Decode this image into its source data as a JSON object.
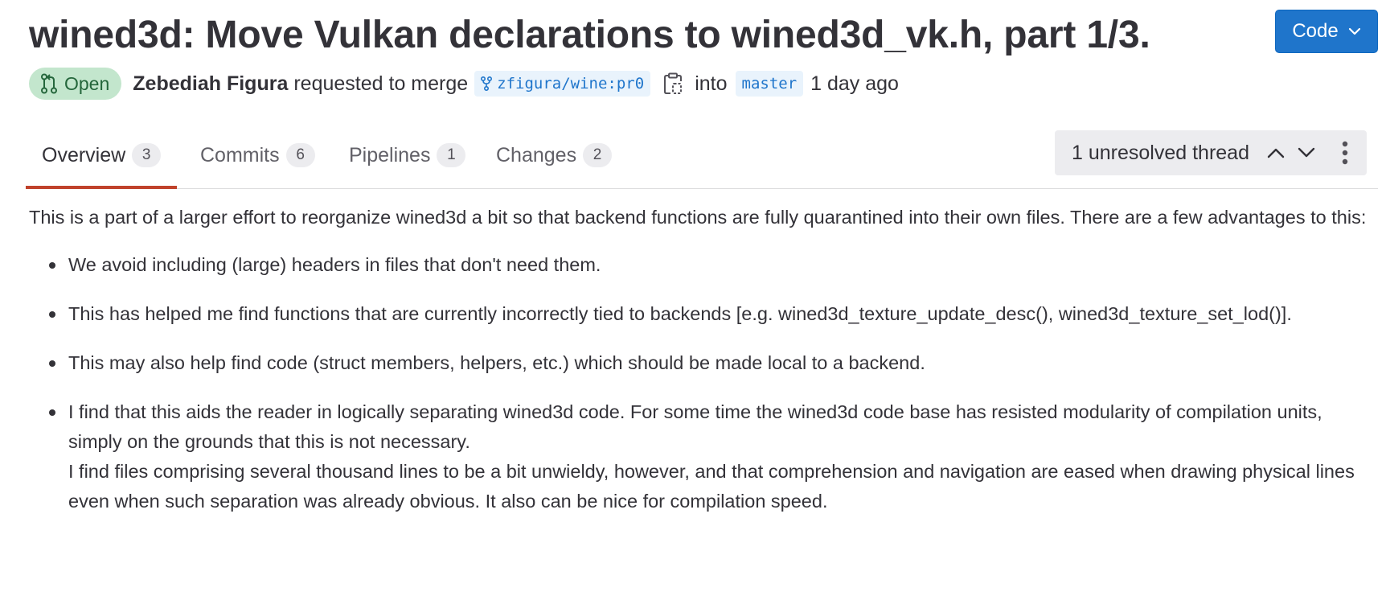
{
  "header": {
    "title": "wined3d: Move Vulkan declarations to wined3d_vk.h, part 1/3.",
    "code_button_label": "Code"
  },
  "meta": {
    "status": "Open",
    "author": "Zebediah Figura",
    "requested_text": "requested to merge",
    "source_branch": "zfigura/wine:pr0",
    "into_text": "into",
    "target_branch": "master",
    "time_ago": "1 day ago"
  },
  "tabs": [
    {
      "label": "Overview",
      "count": "3",
      "active": true
    },
    {
      "label": "Commits",
      "count": "6",
      "active": false
    },
    {
      "label": "Pipelines",
      "count": "1",
      "active": false
    },
    {
      "label": "Changes",
      "count": "2",
      "active": false
    }
  ],
  "threads": {
    "label": "1 unresolved thread"
  },
  "description": {
    "intro": "This is a part of a larger effort to reorganize wined3d a bit so that backend functions are fully quarantined into their own files. There are a few advantages to this:",
    "bullets": [
      {
        "text": "We avoid including (large) headers in files that don't need them."
      },
      {
        "text": "This has helped me find functions that are currently incorrectly tied to backends [e.g. wined3d_texture_update_desc(), wined3d_texture_set_lod()]."
      },
      {
        "text": "This may also help find code (struct members, helpers, etc.) which should be made local to a backend."
      },
      {
        "text": "I find that this aids the reader in logically separating wined3d code. For some time the wined3d code base has resisted modularity of compilation units, simply on the grounds that this is not necessary.",
        "text2": "I find files comprising several thousand lines to be a bit unwieldy, however, and that comprehension and navigation are eased when drawing physical lines even when such separation was already obvious. It also can be nice for compilation speed."
      }
    ]
  },
  "colors": {
    "accent_blue": "#1f75cb",
    "open_badge_bg": "#c3e6cd",
    "open_badge_text": "#24663b",
    "active_tab_underline": "#c0422b"
  },
  "icons": {
    "status": "merge-request-open-icon",
    "branch": "branch-fork-icon",
    "copy": "copy-to-clipboard-icon",
    "code_dropdown": "chevron-down-icon",
    "thread_prev": "chevron-up-icon",
    "thread_next": "chevron-down-icon",
    "thread_more": "kebab-menu-icon"
  }
}
